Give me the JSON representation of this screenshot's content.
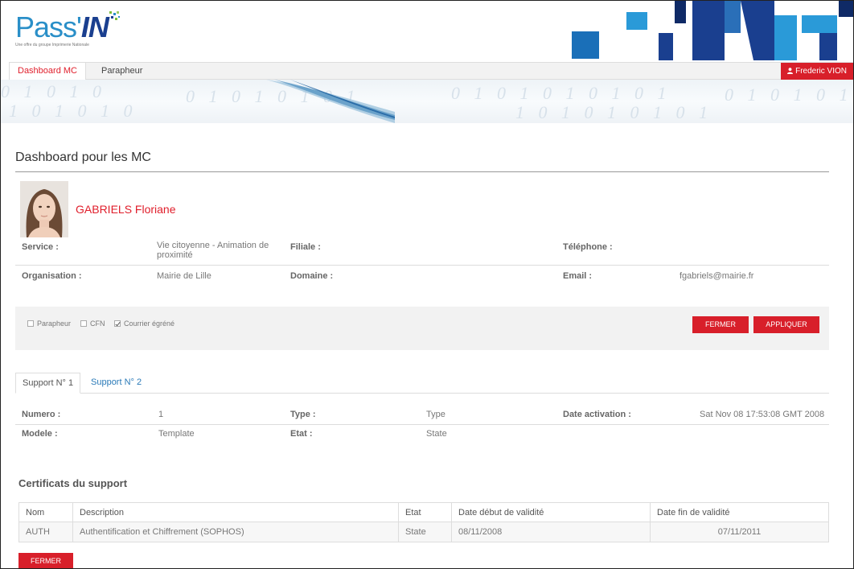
{
  "header": {
    "logo_main": "Pass'",
    "logo_bold": "IN",
    "logo_tagline": "Une offre du groupe Imprimerie Nationale"
  },
  "nav": {
    "items": [
      {
        "label": "Dashboard MC",
        "active": true
      },
      {
        "label": "Parapheur",
        "active": false
      }
    ],
    "user_label": "Frederic VION"
  },
  "page": {
    "title": "Dashboard pour les MC"
  },
  "person": {
    "name": "GABRIELS Floriane",
    "rows": [
      {
        "service_label": "Service :",
        "service_value": "Vie citoyenne - Animation de proximité",
        "filiale_label": "Filiale :",
        "filiale_value": "",
        "telephone_label": "Téléphone :",
        "telephone_value": ""
      },
      {
        "organisation_label": "Organisation :",
        "organisation_value": "Mairie de Lille",
        "domaine_label": "Domaine :",
        "domaine_value": "",
        "email_label": "Email :",
        "email_value": "fgabriels@mairie.fr"
      }
    ]
  },
  "filters": {
    "options": [
      {
        "label": "Parapheur",
        "checked": false
      },
      {
        "label": "CFN",
        "checked": false
      },
      {
        "label": "Courrier égréné",
        "checked": true
      }
    ],
    "close_label": "FERMER",
    "apply_label": "APPLIQUER"
  },
  "tabs": [
    {
      "label": "Support N° 1",
      "active": true
    },
    {
      "label": "Support N° 2",
      "active": false
    }
  ],
  "support": {
    "numero_label": "Numero :",
    "numero_value": "1",
    "type_label": "Type :",
    "type_value": "Type",
    "date_activation_label": "Date activation :",
    "date_activation_value": "Sat Nov 08 17:53:08 GMT 2008",
    "modele_label": "Modele :",
    "modele_value": "Template",
    "etat_label": "Etat :",
    "etat_value": "State"
  },
  "certificates": {
    "title": "Certificats du support",
    "columns": [
      "Nom",
      "Description",
      "Etat",
      "Date début de validité",
      "Date fin de validité"
    ],
    "rows": [
      [
        "AUTH",
        "Authentification et Chiffrement (SOPHOS)",
        "State",
        "08/11/2008",
        "07/11/2011"
      ]
    ]
  },
  "footer": {
    "close_label": "FERMER"
  },
  "colors": {
    "accent_red": "#d81f2a",
    "link_blue": "#2a7ab8",
    "logo_blue": "#2a8fc8",
    "logo_dark_blue": "#1a3f8f"
  }
}
